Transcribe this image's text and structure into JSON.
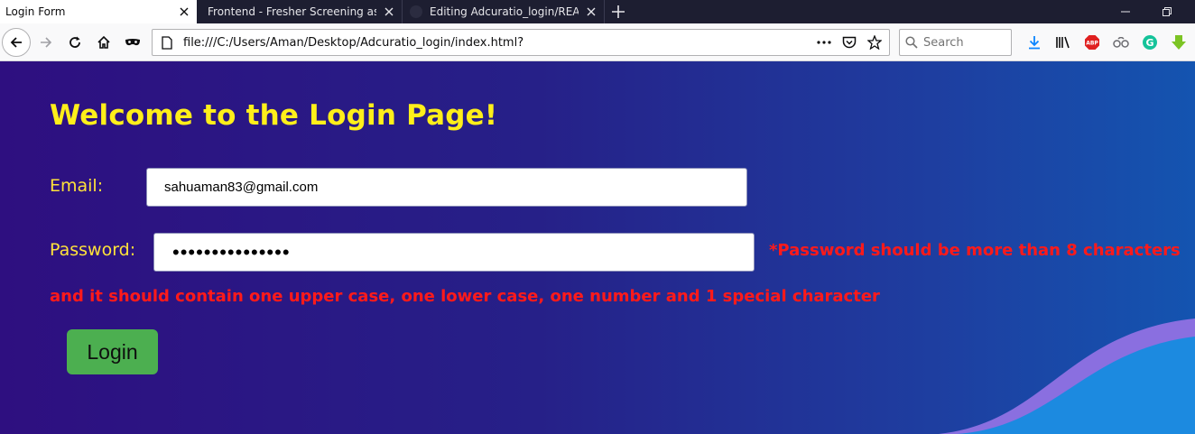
{
  "browser": {
    "tabs": [
      {
        "title": "Login Form",
        "active": true
      },
      {
        "title": "Frontend - Fresher Screening assignm",
        "active": false
      },
      {
        "title": "Editing Adcuratio_login/READM",
        "active": false
      }
    ],
    "url": "file:///C:/Users/Aman/Desktop/Adcuratio_login/index.html?",
    "search_placeholder": "Search",
    "icons": {
      "back": "back-arrow-icon",
      "forward": "forward-arrow-icon",
      "reload": "reload-icon",
      "home": "home-icon",
      "private": "mask-icon",
      "page_actions": "more-dots-icon",
      "pocket": "pocket-icon",
      "bookmark": "star-icon",
      "downloads": "download-icon",
      "library": "library-icon",
      "adblock": "adblock-icon",
      "extension": "extension-icon",
      "grammarly": "grammarly-icon",
      "green_arrow": "green-download-icon"
    }
  },
  "page": {
    "title": "Welcome to the Login Page!",
    "email_label": "Email:",
    "email_value": "sahuaman83@gmail.com",
    "password_label": "Password:",
    "password_value": "•••••••••••••••",
    "error_line1": "*Password should be more than 8 characters",
    "error_line2": "and it should contain one upper case, one lower case, one number and 1 special character",
    "login_label": "Login"
  },
  "colors": {
    "title": "#ffef1a",
    "label": "#ffe23a",
    "error": "#ff1a1a",
    "button": "#4caf50",
    "bg_start": "#2e0f80",
    "bg_end": "#1454b0"
  }
}
